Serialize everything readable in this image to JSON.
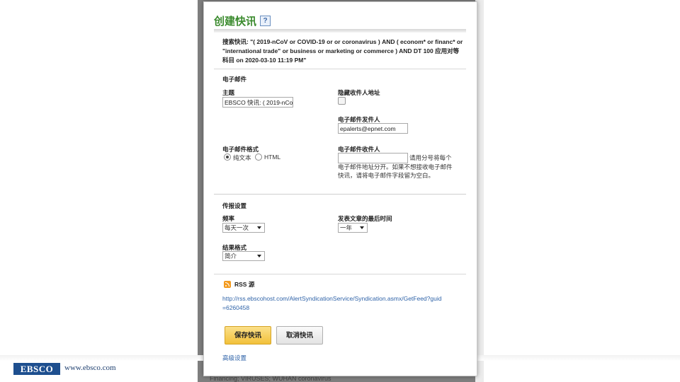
{
  "dialog": {
    "title": "创建快讯",
    "help_icon_glyph": "?",
    "search_text": "搜索快讯: \"( 2019-nCoV or COVID-19 or or coronavirus ) AND ( econom* or financ* or \"international trade\" or business or marketing or commerce ) AND DT 100 应用对等科目 on 2020-03-10 11:19 PM\""
  },
  "email": {
    "section_title": "电子邮件",
    "subject_label": "主题",
    "subject_value": "EBSCO 快讯: ( 2019-nCo",
    "hide_recipients_label": "隐藏收件人地址",
    "hide_recipients_checked": false,
    "sender_label": "电子邮件发件人",
    "sender_value": "epalerts@epnet.com",
    "format_label": "电子邮件格式",
    "format_options": [
      "纯文本",
      "HTML"
    ],
    "format_selected": "纯文本",
    "recipient_label": "电子邮件收件人",
    "recipient_value": "",
    "recipient_help": "请用分号将每个电子邮件地址分开。如果不想接收电子邮件快讯，请将电子邮件字段留为空白。"
  },
  "schedule": {
    "section_title": "传报设置",
    "frequency_label": "频率",
    "frequency_value": "每天一次",
    "max_age_label": "发表文章的最后时间",
    "max_age_value": "一年",
    "result_format_label": "结果格式",
    "result_format_value": "简介"
  },
  "rss": {
    "label": "RSS 源",
    "link": "http://rss.ebscohost.com/AlertSyndicationService/Syndication.asmx/GetFeed?guid=6260458"
  },
  "buttons": {
    "save": "保存快讯",
    "cancel": "取消快讯",
    "advanced": "高级设置"
  },
  "footer": {
    "logo_text": "EBSCO",
    "url": "www.ebsco.com"
  },
  "background": {
    "bottom_text": "Financing; VIRUSES; WUHAN coronavirus"
  },
  "colors": {
    "title_green": "#3b8b2e",
    "link_blue": "#2f63a8",
    "save_yellow": "#f2c13a",
    "ebsco_blue": "#1e4f8f"
  }
}
